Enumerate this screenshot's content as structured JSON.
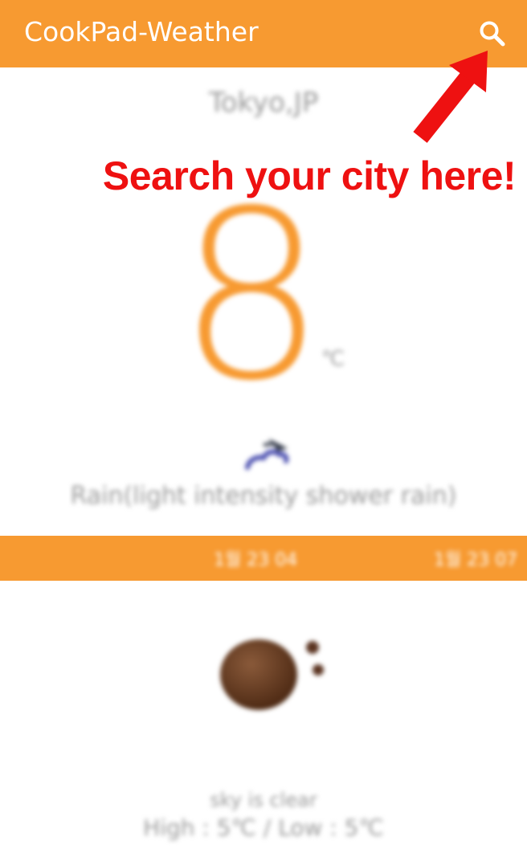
{
  "appbar": {
    "title": "CookPad-Weather",
    "search_icon": "search-icon",
    "background": "#F79A31"
  },
  "current": {
    "city": "Tokyo,JP",
    "temperature": "8",
    "unit": "℃",
    "icon": "rain-cloud-icon",
    "description": "Rain(light intensity shower rain)"
  },
  "forecast": {
    "tabs": [
      {
        "label": "1월 23 04"
      },
      {
        "label": "1월 23 07"
      }
    ],
    "icon": "clear-sky-moon-icon",
    "description": "sky is clear",
    "temps": "High : 5℃ / Low : 5℃"
  },
  "annotation": {
    "text": "Search your city here!",
    "color": "#EE1111"
  }
}
